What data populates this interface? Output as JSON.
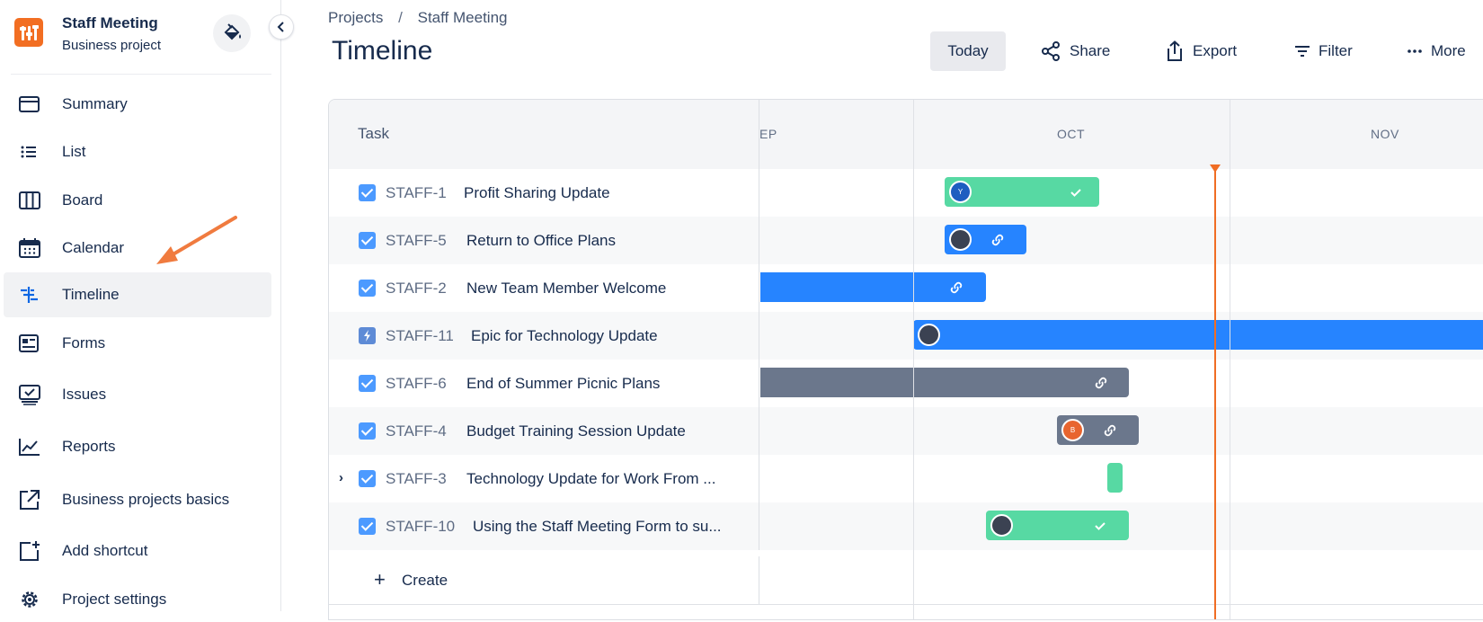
{
  "project": {
    "name": "Staff Meeting",
    "type": "Business project"
  },
  "nav": [
    {
      "label": "Summary",
      "icon": "summary-icon"
    },
    {
      "label": "List",
      "icon": "list-icon"
    },
    {
      "label": "Board",
      "icon": "board-icon"
    },
    {
      "label": "Calendar",
      "icon": "calendar-icon"
    },
    {
      "label": "Timeline",
      "icon": "timeline-icon",
      "active": true
    },
    {
      "label": "Forms",
      "icon": "forms-icon"
    },
    {
      "label": "Issues",
      "icon": "issues-icon"
    },
    {
      "label": "Reports",
      "icon": "reports-icon"
    },
    {
      "label": "Business projects basics",
      "icon": "external-link-icon"
    },
    {
      "label": "Add shortcut",
      "icon": "add-shortcut-icon"
    },
    {
      "label": "Project settings",
      "icon": "gear-icon"
    }
  ],
  "breadcrumb": {
    "root": "Projects",
    "separator": "/",
    "current": "Staff Meeting"
  },
  "page": {
    "title": "Timeline"
  },
  "toolbar": {
    "today": "Today",
    "share": "Share",
    "export": "Export",
    "filter": "Filter",
    "more": "More"
  },
  "timeline": {
    "task_header": "Task",
    "months": [
      "EP",
      "OCT",
      "NOV"
    ],
    "rows": [
      {
        "key": "STAFF-1",
        "title": "Profit Sharing Update",
        "type": "task",
        "bar_color": "green",
        "avatar": "Y",
        "bar_icon": "check-icon"
      },
      {
        "key": "STAFF-5",
        "title": "Return to Office Plans",
        "type": "task",
        "bar_color": "blue",
        "avatar": "photo",
        "bar_icon": "link-icon"
      },
      {
        "key": "STAFF-2",
        "title": "New Team Member Welcome",
        "type": "task",
        "bar_color": "blue",
        "bar_icon": "link-icon"
      },
      {
        "key": "STAFF-11",
        "title": "Epic for Technology Update",
        "type": "epic",
        "bar_color": "blue",
        "avatar": "photo"
      },
      {
        "key": "STAFF-6",
        "title": "End of Summer Picnic Plans",
        "type": "task",
        "bar_color": "gray",
        "bar_icon": "link-icon"
      },
      {
        "key": "STAFF-4",
        "title": "Budget Training Session Update",
        "type": "task",
        "bar_color": "gray",
        "avatar": "B",
        "bar_icon": "link-icon"
      },
      {
        "key": "STAFF-3",
        "title": "Technology Update for Work From ...",
        "type": "task",
        "bar_color": "green",
        "expandable": true
      },
      {
        "key": "STAFF-10",
        "title": "Using the Staff Meeting Form to su...",
        "type": "task",
        "bar_color": "green",
        "avatar": "photo",
        "bar_icon": "check-icon"
      }
    ],
    "create_label": "Create"
  },
  "colors": {
    "accent": "#0c66e4",
    "today_line": "#f06d24",
    "green_bar": "#57d9a3",
    "blue_bar": "#2684ff",
    "gray_bar": "#6b778c",
    "annotation_arrow": "#f07b3f"
  }
}
